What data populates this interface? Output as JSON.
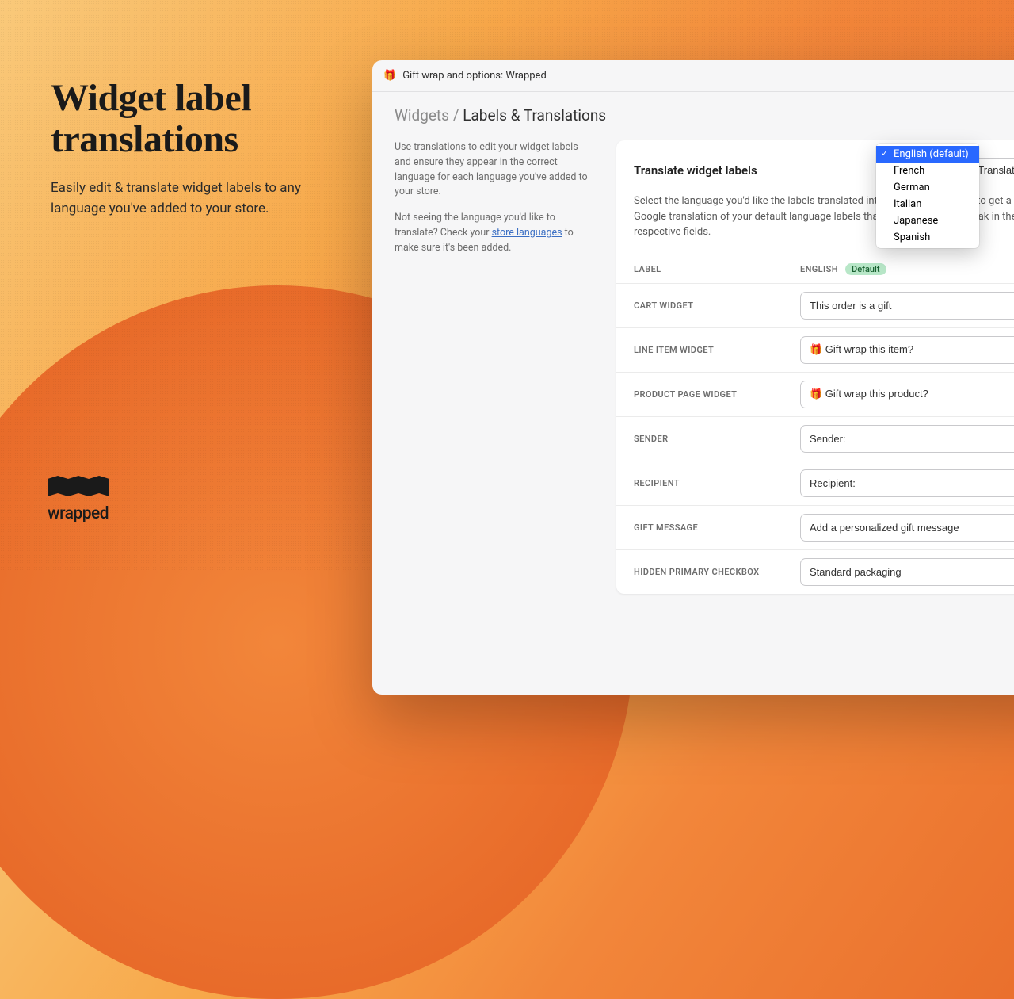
{
  "marketing": {
    "title": "Widget label translations",
    "subtitle": "Easily edit & translate widget labels to any language you've added to your store.",
    "brand": "wrapped"
  },
  "titlebar": {
    "icon": "🎁",
    "text": "Gift wrap and options: Wrapped"
  },
  "breadcrumb": {
    "parent": "Widgets",
    "sep": " / ",
    "current": "Labels & Translations"
  },
  "sidehelp": {
    "p1": "Use translations to edit your widget labels and ensure they appear in the correct language for each language you've added to your store.",
    "p2_a": "Not seeing the language you'd like to translate? Check your ",
    "p2_link": "store languages",
    "p2_b": " to make sure it's been added."
  },
  "card": {
    "title": "Translate widget labels",
    "translate_btn": "Translate",
    "desc": "Select the language you'd like the labels translated into, then click translate to get a Google translation of your default language labels that you can edit and tweak in their respective fields."
  },
  "dropdown": {
    "items": [
      "English (default)",
      "French",
      "German",
      "Italian",
      "Japanese",
      "Spanish"
    ],
    "selected": 0
  },
  "table": {
    "head_label": "Label",
    "head_lang": "English",
    "head_badge": "Default"
  },
  "rows": [
    {
      "label": "Cart Widget",
      "value": "This order is a gift"
    },
    {
      "label": "Line Item Widget",
      "value": "🎁 Gift wrap this item?"
    },
    {
      "label": "Product Page Widget",
      "value": "🎁 Gift wrap this product?"
    },
    {
      "label": "Sender",
      "value": "Sender:"
    },
    {
      "label": "Recipient",
      "value": "Recipient:"
    },
    {
      "label": "Gift Message",
      "value": "Add a personalized gift message"
    },
    {
      "label": "Hidden Primary Checkbox",
      "value": "Standard packaging"
    }
  ]
}
